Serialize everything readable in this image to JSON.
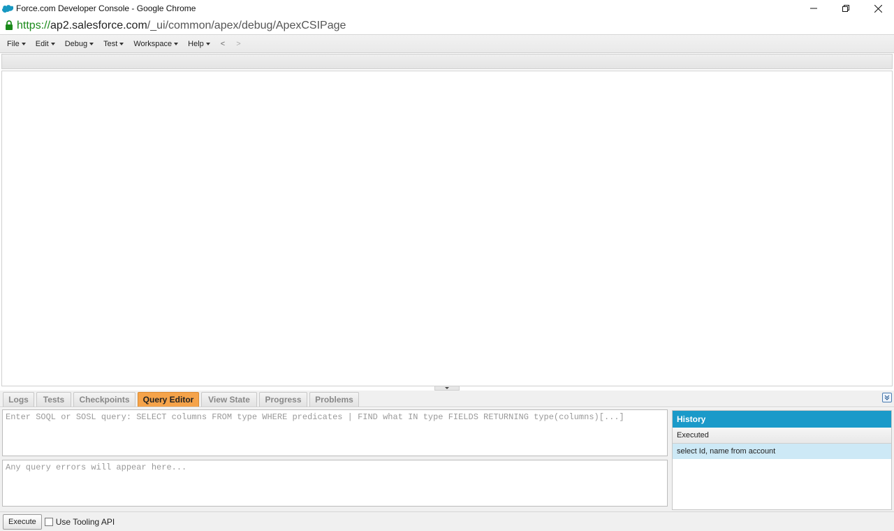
{
  "window": {
    "title": "Force.com Developer Console - Google Chrome",
    "app_icon": "salesforce-cloud-icon",
    "controls": [
      "minimize-icon",
      "restore-icon",
      "close-icon"
    ]
  },
  "address": {
    "lock_icon": "lock-icon",
    "scheme": "https://",
    "host": "ap2.salesforce.com",
    "path": "/_ui/common/apex/debug/ApexCSIPage"
  },
  "menubar": {
    "items": [
      "File",
      "Edit",
      "Debug",
      "Test",
      "Workspace",
      "Help"
    ],
    "back": "<",
    "forward": ">"
  },
  "bottom_tabs": {
    "items": [
      "Logs",
      "Tests",
      "Checkpoints",
      "Query Editor",
      "View State",
      "Progress",
      "Problems"
    ],
    "active": "Query Editor"
  },
  "query_editor": {
    "query_placeholder": "Enter SOQL or SOSL query: SELECT columns FROM type WHERE predicates | FIND what IN type FIELDS RETURNING type(columns)[...]",
    "query_value": "",
    "errors_placeholder": "Any query errors will appear here..."
  },
  "history": {
    "title": "History",
    "column": "Executed",
    "rows": [
      "select Id, name from account"
    ]
  },
  "actions": {
    "execute_label": "Execute",
    "tooling_label": "Use Tooling API",
    "tooling_checked": false
  },
  "colors": {
    "active_tab": "#f5a34a",
    "history_header": "#1a9ac9",
    "history_row_selected": "#cde9f6",
    "url_scheme": "#1a8a1a"
  }
}
